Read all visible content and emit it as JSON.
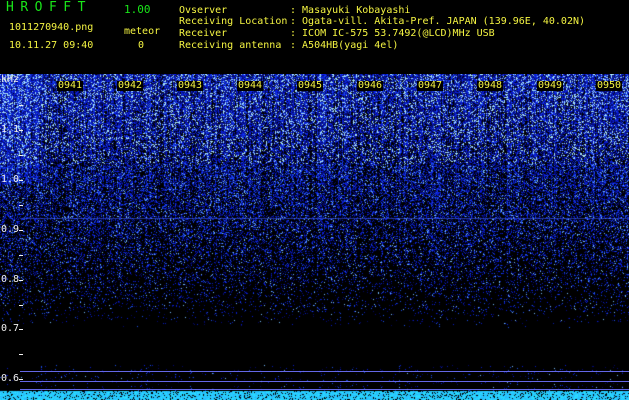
{
  "app": {
    "name": "HROFFT",
    "version": "1.00",
    "filename": "1011270940.png",
    "datetime": "10.11.27 09:40",
    "meteor_label": "meteor",
    "meteor_count": "0"
  },
  "info": {
    "observer_key": "Ovserver",
    "observer_val": ": Masayuki Kobayashi",
    "location_key": "Receiving Location",
    "location_val": ": Ogata-vill. Akita-Pref. JAPAN (139.96E, 40.02N)",
    "receiver_key": "Receiver",
    "receiver_val": ": ICOM IC-575 53.7492(@LCD)MHz USB",
    "antenna_key": "Receiving antenna",
    "antenna_val": ": A504HB(yagi 4el)"
  },
  "spectrogram": {
    "freq_unit": "kHz",
    "freq_labels": [
      "1.1",
      "1.0",
      "0.9",
      "0.8",
      "0.7",
      "0.6"
    ],
    "time_labels": [
      "0941",
      "0942",
      "0943",
      "0944",
      "0945",
      "0946",
      "0947",
      "0948",
      "0949",
      "0950"
    ],
    "colors": {
      "background": "#000000",
      "noise": "#1a3cff",
      "hot": "#9fd4ff",
      "text_green": "#19e619",
      "text_yellow": "#f5f542"
    }
  }
}
